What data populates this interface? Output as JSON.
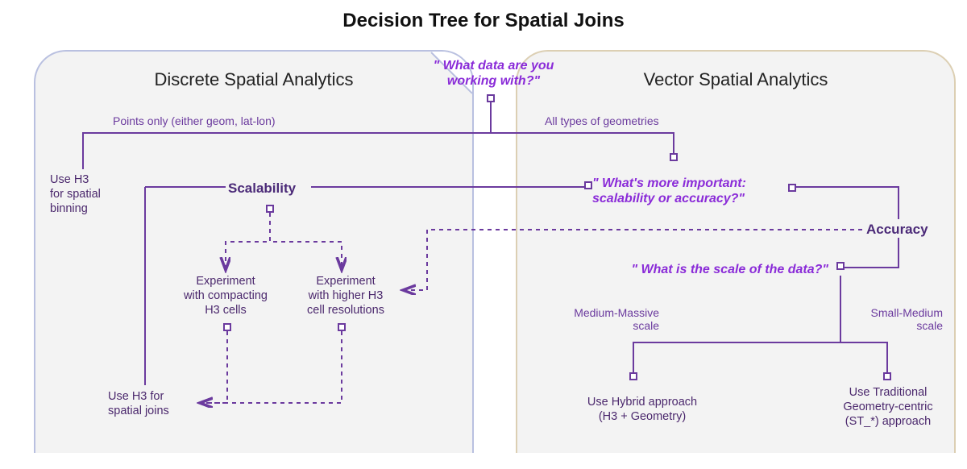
{
  "title": "Decision Tree for Spatial Joins",
  "panels": {
    "discrete": {
      "label": "Discrete Spatial Analytics"
    },
    "vector": {
      "label": "Vector Spatial Analytics"
    }
  },
  "questions": {
    "q_root": "\" What data are you\nworking with?\"",
    "q_importance": "\" What's more important:\nscalability or accuracy?\"",
    "q_scale": "\" What is the scale of the data?\""
  },
  "edge_labels": {
    "points_only": "Points only (either geom, lat-lon)",
    "all_geom": "All types of geometries",
    "med_massive": "Medium-Massive\nscale",
    "small_med": "Small-Medium\nscale"
  },
  "strong": {
    "scalability": "Scalability",
    "accuracy": "Accuracy"
  },
  "boxes": {
    "h3_bin": "Use H3\nfor spatial\nbinning",
    "compact": "Experiment\nwith compacting\nH3 cells",
    "higher": "Experiment\nwith higher H3\ncell resolutions",
    "h3_join": "Use H3 for\nspatial joins",
    "hybrid": "Use Hybrid approach\n(H3 + Geometry)",
    "trad": "Use Traditional\nGeometry-centric\n(ST_*) approach"
  }
}
